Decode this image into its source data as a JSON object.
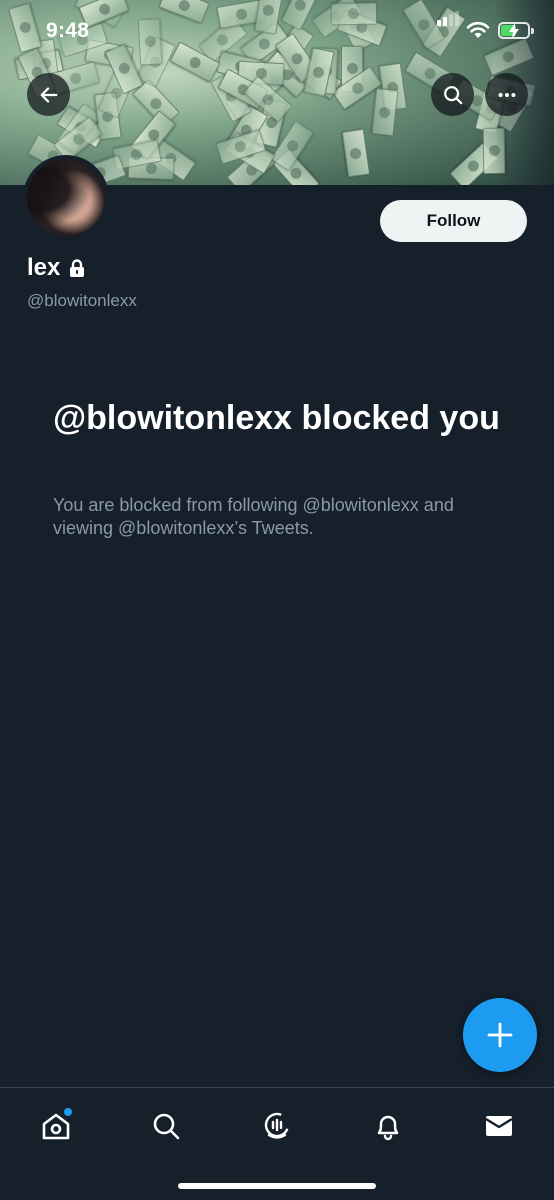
{
  "status_bar": {
    "time": "9:48"
  },
  "header": {
    "back_icon": "arrow-left-icon",
    "search_icon": "search-icon",
    "more_icon": "more-horizontal-icon"
  },
  "profile": {
    "display_name": "lex",
    "handle": "@blowitonlexx",
    "protected_icon": "lock-icon",
    "follow_label": "Follow"
  },
  "blocked_notice": {
    "title": "@blowitonlexx blocked you",
    "description": "You are blocked from following @blowitonlexx and viewing @blowitonlexx’s Tweets."
  },
  "compose_button": {
    "icon": "plus-icon"
  },
  "bottom_nav": {
    "items": [
      {
        "name": "home",
        "icon": "home-icon",
        "has_notification_dot": true
      },
      {
        "name": "search",
        "icon": "search-icon",
        "has_notification_dot": false
      },
      {
        "name": "spaces",
        "icon": "spaces-icon",
        "has_notification_dot": false
      },
      {
        "name": "notifications",
        "icon": "bell-icon",
        "has_notification_dot": false
      },
      {
        "name": "messages",
        "icon": "mail-icon",
        "has_notification_dot": false
      }
    ]
  },
  "colors": {
    "background": "#15202b",
    "accent": "#1d9bf0",
    "secondary_text": "#8b98a5",
    "follow_button_bg": "#eff3f4"
  }
}
